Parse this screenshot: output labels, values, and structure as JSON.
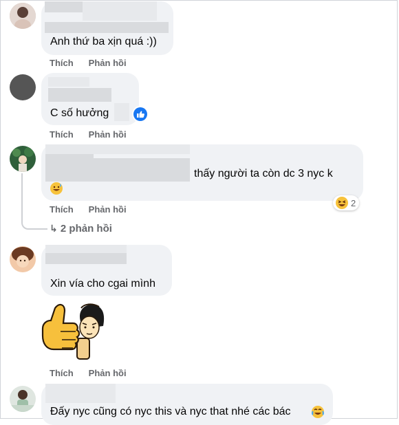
{
  "comments": [
    {
      "text": "Anh thứ ba xịn quá :))",
      "actions": {
        "like": "Thích",
        "reply": "Phản hồi"
      }
    },
    {
      "text": "C số hưởng",
      "actions": {
        "like": "Thích",
        "reply": "Phản hồi"
      },
      "reaction_icon": "like-icon"
    },
    {
      "text": "thấy người ta còn dc 3 nyc k",
      "actions": {
        "like": "Thích",
        "reply": "Phản hồi"
      },
      "replies_link": "2 phản hồi",
      "reaction_count": "2",
      "emoji": "grinning-sweat-emoji",
      "reaction_emoji": "laughing-squint-emoji"
    },
    {
      "text": "Xin vía cho cgai mình",
      "actions": {
        "like": "Thích",
        "reply": "Phản hồi"
      },
      "sticker": "thumbs-up-sticker"
    },
    {
      "text": "Đấy nyc cũng có nyc this và nyc that nhé các bác",
      "emoji": "crying-laughing-emoji"
    }
  ],
  "colors": {
    "bubble": "#f0f2f5",
    "action_text": "#65676b",
    "like_blue": "#1877f2",
    "emoji_yellow": "#f7c23b"
  }
}
